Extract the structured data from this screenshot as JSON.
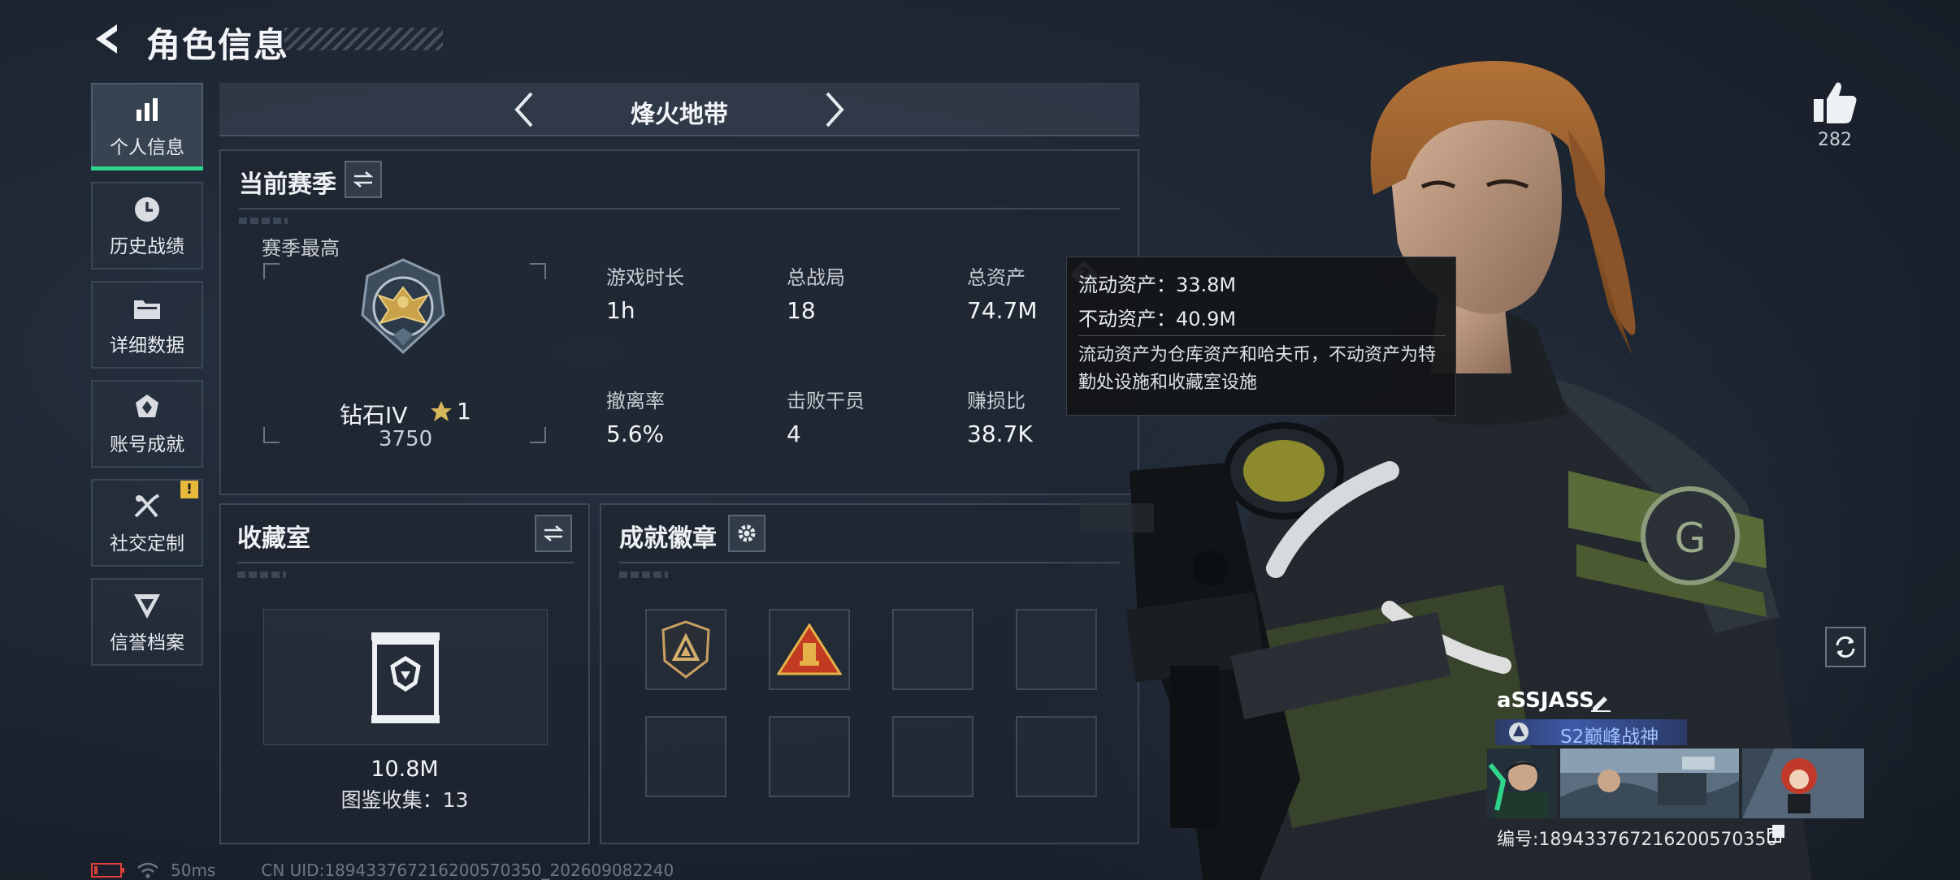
{
  "header": {
    "title": "角色信息"
  },
  "sidebar": {
    "items": [
      {
        "label": "个人信息",
        "icon": "bar-chart-icon",
        "active": true
      },
      {
        "label": "历史战绩",
        "icon": "history-icon"
      },
      {
        "label": "详细数据",
        "icon": "folder-icon"
      },
      {
        "label": "账号成就",
        "icon": "achievement-icon"
      },
      {
        "label": "社交定制",
        "icon": "tools-icon",
        "badge": "!"
      },
      {
        "label": "信誉档案",
        "icon": "reputation-icon"
      }
    ]
  },
  "mode": {
    "title": "烽火地带"
  },
  "season": {
    "title": "当前赛季",
    "best_label": "赛季最高",
    "rank_name": "钻石IV",
    "rank_stars": "1",
    "rank_score": "3750",
    "stats": [
      {
        "label": "游戏时长",
        "value": "1h"
      },
      {
        "label": "总战局",
        "value": "18"
      },
      {
        "label": "总资产",
        "value": "74.7M",
        "has_help": true
      },
      {
        "label": "撤离率",
        "value": "5.6%"
      },
      {
        "label": "击败干员",
        "value": "4"
      },
      {
        "label": "赚损比",
        "value": "38.7K"
      }
    ]
  },
  "tooltip": {
    "liquid": "流动资产：33.8M",
    "fixed": "不动资产：40.9M",
    "note": "流动资产为仓库资产和哈夫币，不动资产为特勤处设施和收藏室设施"
  },
  "collection": {
    "title": "收藏室",
    "value": "10.8M",
    "count_text": "图鉴收集：13"
  },
  "achievements": {
    "title": "成就徽章"
  },
  "likes": {
    "count": "282"
  },
  "player": {
    "name": "aSSJASS",
    "title": "S2巅峰战神",
    "id_text": "编号:18943376721620057035​0"
  },
  "status": {
    "ping": "50ms",
    "uid": "CN UID:18943376721620057035​0_202609082240"
  },
  "colors": {
    "accent_green": "#2fd58a",
    "badge_yellow": "#e6b93a",
    "battery_red": "#e0403a"
  }
}
